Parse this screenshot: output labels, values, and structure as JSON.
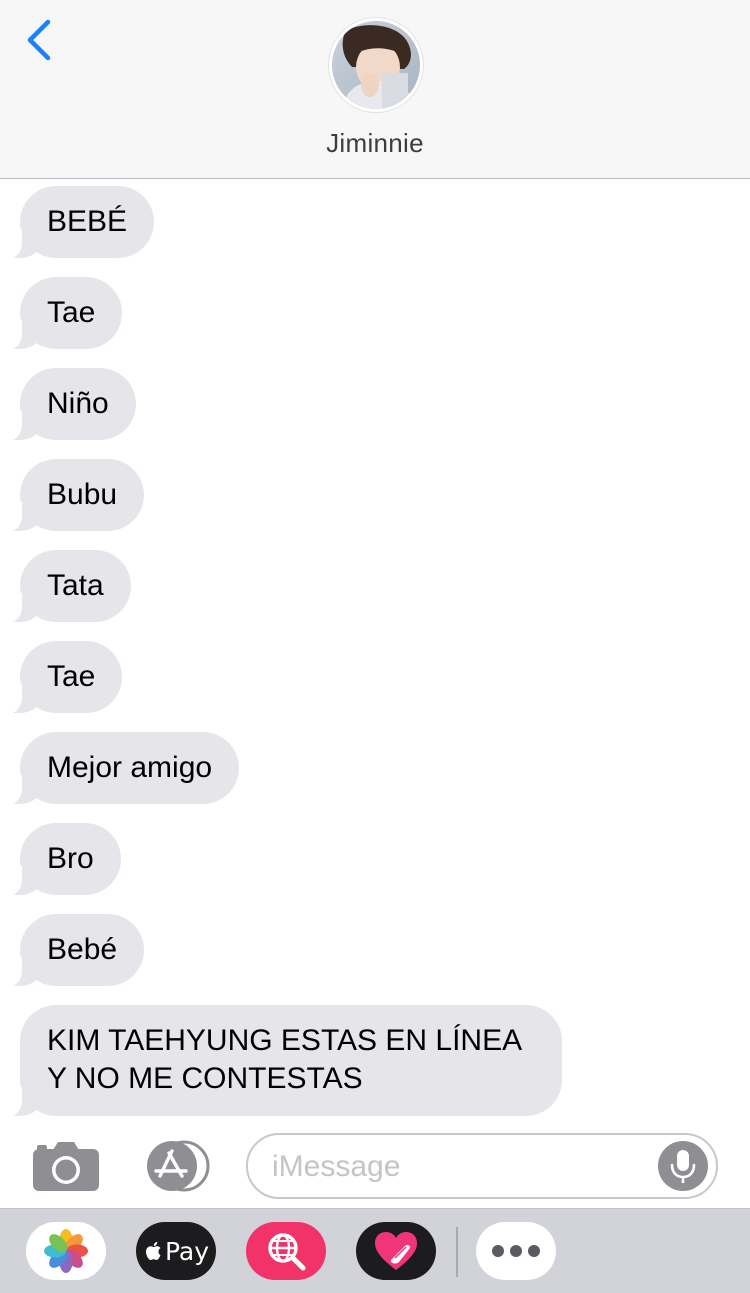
{
  "header": {
    "contact_name": "Jiminnie",
    "back_icon": "chevron-left-icon",
    "avatar_icon": "contact-avatar"
  },
  "messages": [
    {
      "text": "BEBÉ",
      "direction": "received"
    },
    {
      "text": "Tae",
      "direction": "received"
    },
    {
      "text": "Niño",
      "direction": "received"
    },
    {
      "text": "Bubu",
      "direction": "received"
    },
    {
      "text": "Tata",
      "direction": "received"
    },
    {
      "text": "Tae",
      "direction": "received"
    },
    {
      "text": "Mejor amigo",
      "direction": "received"
    },
    {
      "text": "Bro",
      "direction": "received"
    },
    {
      "text": "Bebé",
      "direction": "received"
    },
    {
      "text": "KIM TAEHYUNG ESTAS EN LÍNEA Y NO ME CONTESTAS",
      "direction": "received"
    }
  ],
  "input": {
    "placeholder": "iMessage",
    "camera_icon": "camera-icon",
    "appstore_icon": "app-store-icon",
    "mic_icon": "microphone-icon"
  },
  "drawer": {
    "apps": [
      {
        "name": "photos-app-icon"
      },
      {
        "name": "apple-pay-icon",
        "label": "Pay"
      },
      {
        "name": "web-images-search-icon"
      },
      {
        "name": "digital-touch-icon"
      },
      {
        "name": "more-apps-icon"
      }
    ]
  },
  "colors": {
    "received_bubble": "#e5e5ea",
    "accent": "#007aff",
    "drawer_bg": "#d2d3d8",
    "search_app": "#f2336a"
  }
}
